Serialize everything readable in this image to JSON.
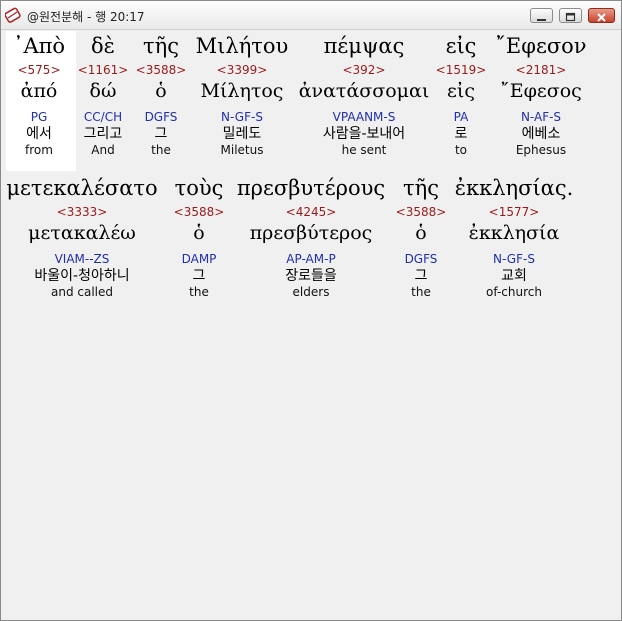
{
  "window": {
    "title": "@원전분해 - 행 20:17"
  },
  "verse": [
    [
      {
        "word": "᾿Απὸ",
        "strong": "<575>",
        "lemma": "ἀπό",
        "morph": "PG",
        "korean": "에서",
        "english": "from"
      },
      {
        "word": "δὲ",
        "strong": "<1161>",
        "lemma": "δώ",
        "morph": "CC/CH",
        "korean": "그리고",
        "english": "And"
      },
      {
        "word": "τῆς",
        "strong": "<3588>",
        "lemma": "ὁ",
        "morph": "DGFS",
        "korean": "그",
        "english": "the"
      },
      {
        "word": "Μιλήτου",
        "strong": "<3399>",
        "lemma": "Μίλητος",
        "morph": "N-GF-S",
        "korean": "밀레도",
        "english": "Miletus"
      },
      {
        "word": "πέμψας",
        "strong": "<392>",
        "lemma": "ἀνατάσσομαι",
        "morph": "VPAANM-S",
        "korean": "사람을-보내어",
        "english": "he sent"
      },
      {
        "word": "εἰς",
        "strong": "<1519>",
        "lemma": "εἰς",
        "morph": "PA",
        "korean": "로",
        "english": "to"
      },
      {
        "word": "῎Εφεσον",
        "strong": "<2181>",
        "lemma": "῎Εφεσος",
        "morph": "N-AF-S",
        "korean": "에베소",
        "english": "Ephesus"
      }
    ],
    [
      {
        "word": "μετεκαλέσατο",
        "strong": "<3333>",
        "lemma": "μετακαλέω",
        "morph": "VIAM--ZS",
        "korean": "바울이-청아하니",
        "english": "and called"
      },
      {
        "word": "τοὺς",
        "strong": "<3588>",
        "lemma": "ὁ",
        "morph": "DAMP",
        "korean": "그",
        "english": "the"
      },
      {
        "word": "πρεσβυτέρους",
        "strong": "<4245>",
        "lemma": "πρεσβύτερος",
        "morph": "AP-AM-P",
        "korean": "장로들을",
        "english": "elders"
      },
      {
        "word": "τῆς",
        "strong": "<3588>",
        "lemma": "ὁ",
        "morph": "DGFS",
        "korean": "그",
        "english": "the"
      },
      {
        "word": "ἐκκλησίας.",
        "strong": "<1577>",
        "lemma": "ἐκκλησία",
        "morph": "N-GF-S",
        "korean": "교회",
        "english": "of-church"
      }
    ]
  ]
}
